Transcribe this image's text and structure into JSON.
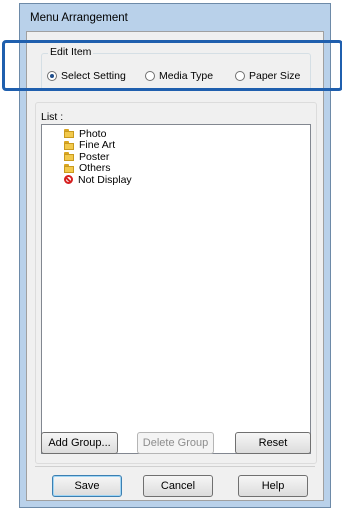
{
  "dialog": {
    "title": "Menu Arrangement"
  },
  "edit_item": {
    "label": "Edit Item",
    "options": [
      {
        "label": "Select Setting",
        "selected": true
      },
      {
        "label": "Media Type",
        "selected": false
      },
      {
        "label": "Paper Size",
        "selected": false
      }
    ]
  },
  "list": {
    "label": "List :",
    "items": [
      {
        "label": "Photo",
        "icon": "folder-icon"
      },
      {
        "label": "Fine Art",
        "icon": "folder-icon"
      },
      {
        "label": "Poster",
        "icon": "folder-icon"
      },
      {
        "label": "Others",
        "icon": "folder-icon"
      },
      {
        "label": "Not Display",
        "icon": "no-display-icon"
      }
    ]
  },
  "buttons": {
    "add_group": "Add Group...",
    "delete_group": "Delete Group",
    "reset": "Reset",
    "save": "Save",
    "cancel": "Cancel",
    "help": "Help"
  },
  "colors": {
    "highlight": "#1f5fae",
    "window_frame": "#b9d1ea"
  }
}
